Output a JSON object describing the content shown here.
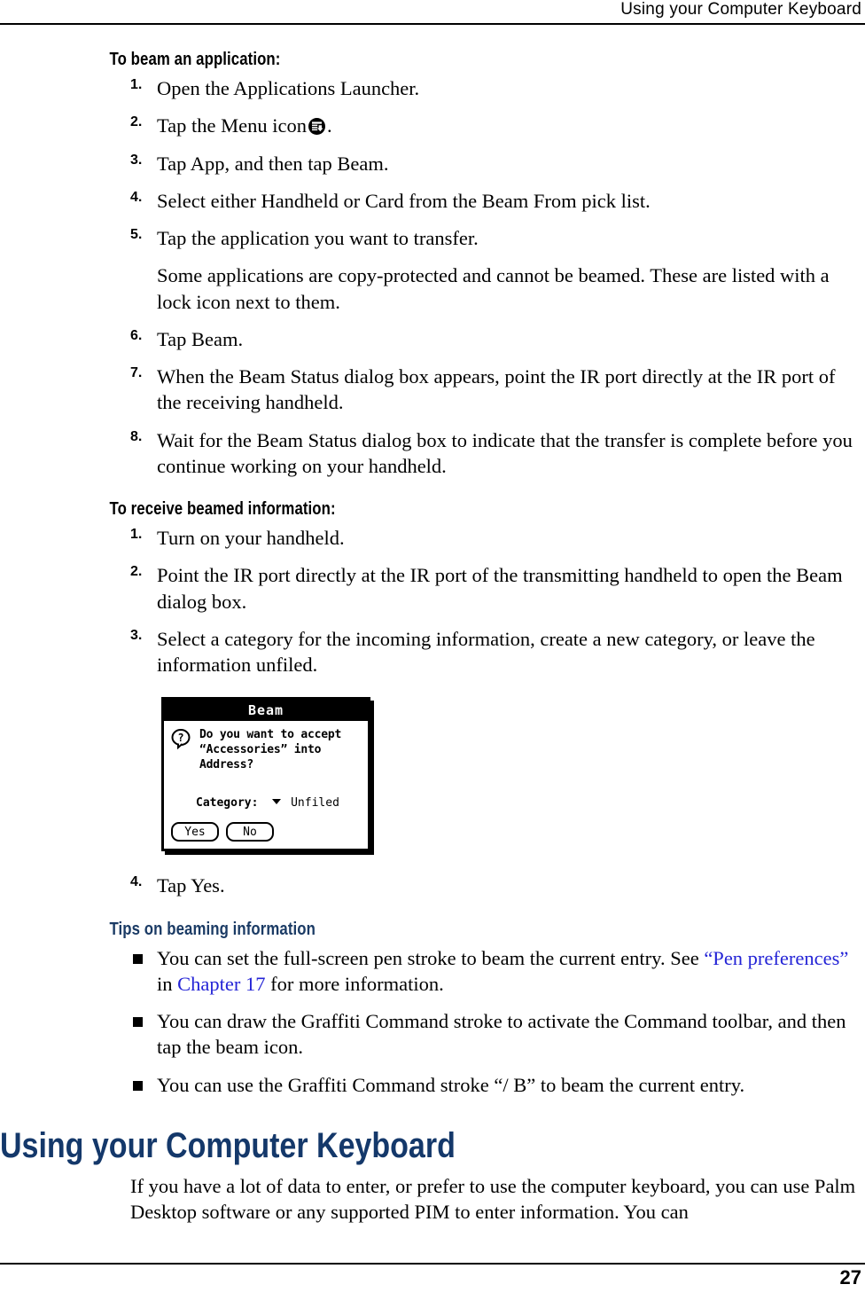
{
  "header": {
    "running_title": "Using your Computer Keyboard"
  },
  "footer": {
    "page_number": "27"
  },
  "sections": {
    "beam_app": {
      "heading": "To beam an application:",
      "steps": [
        {
          "num": "1.",
          "text": "Open the Applications Launcher."
        },
        {
          "num": "2.",
          "text_before": "Tap the Menu icon",
          "icon": "menu-icon",
          "text_after": "."
        },
        {
          "num": "3.",
          "text": "Tap App, and then tap Beam."
        },
        {
          "num": "4.",
          "text": "Select either Handheld or Card from the Beam From pick list."
        },
        {
          "num": "5.",
          "text": "Tap the application you want to transfer."
        },
        {
          "num": "6.",
          "text": "Tap Beam."
        },
        {
          "num": "7.",
          "text": "When the Beam Status dialog box appears, point the IR port directly at the IR port of the receiving handheld."
        },
        {
          "num": "8.",
          "text": "Wait for the Beam Status dialog box to indicate that the transfer is complete before you continue working on your handheld."
        }
      ],
      "step5_note": "Some applications are copy-protected and cannot be beamed. These are listed with a lock icon next to them."
    },
    "receive_beamed": {
      "heading": "To receive beamed information:",
      "steps": [
        {
          "num": "1.",
          "text": "Turn on your handheld."
        },
        {
          "num": "2.",
          "text": "Point the IR port directly at the IR port of the transmitting handheld to open the Beam dialog box."
        },
        {
          "num": "3.",
          "text": "Select a category for the incoming information, create a new category, or leave the information unfiled."
        },
        {
          "num": "4.",
          "text": "Tap Yes."
        }
      ]
    },
    "tips": {
      "heading": "Tips on beaming information",
      "items": [
        {
          "part1": "You can set the full-screen pen stroke to beam the current entry. See ",
          "link1": "“Pen preferences”",
          "part2": " in ",
          "link2": "Chapter 17",
          "part3": " for more information."
        },
        {
          "part1": "You can draw the Graffiti Command stroke to activate the Command toolbar, and then tap the beam icon.",
          "link1": "",
          "part2": "",
          "link2": "",
          "part3": ""
        },
        {
          "part1": "You can use the Graffiti Command stroke “/ B” to beam the current entry.",
          "link1": "",
          "part2": "",
          "link2": "",
          "part3": ""
        }
      ]
    },
    "keyboard": {
      "heading": "Using your Computer Keyboard",
      "paragraph": "If you have a lot of data to enter, or prefer to use the computer keyboard, you can use Palm Desktop software or any supported PIM to enter information. You can"
    }
  },
  "palm_dialog": {
    "title": "Beam",
    "icon": "question-bubble-icon",
    "message_lines": [
      "Do you want to accept",
      "“Accessories” into",
      "Address?"
    ],
    "category_label": "Category:",
    "category_value": "Unfiled",
    "buttons": [
      {
        "label": "Yes"
      },
      {
        "label": "No"
      }
    ]
  },
  "colors": {
    "heading_blue": "#14386a",
    "subhead_blue": "#1b3b65",
    "link_blue": "#2424d6",
    "text": "#000000",
    "background": "#ffffff"
  }
}
